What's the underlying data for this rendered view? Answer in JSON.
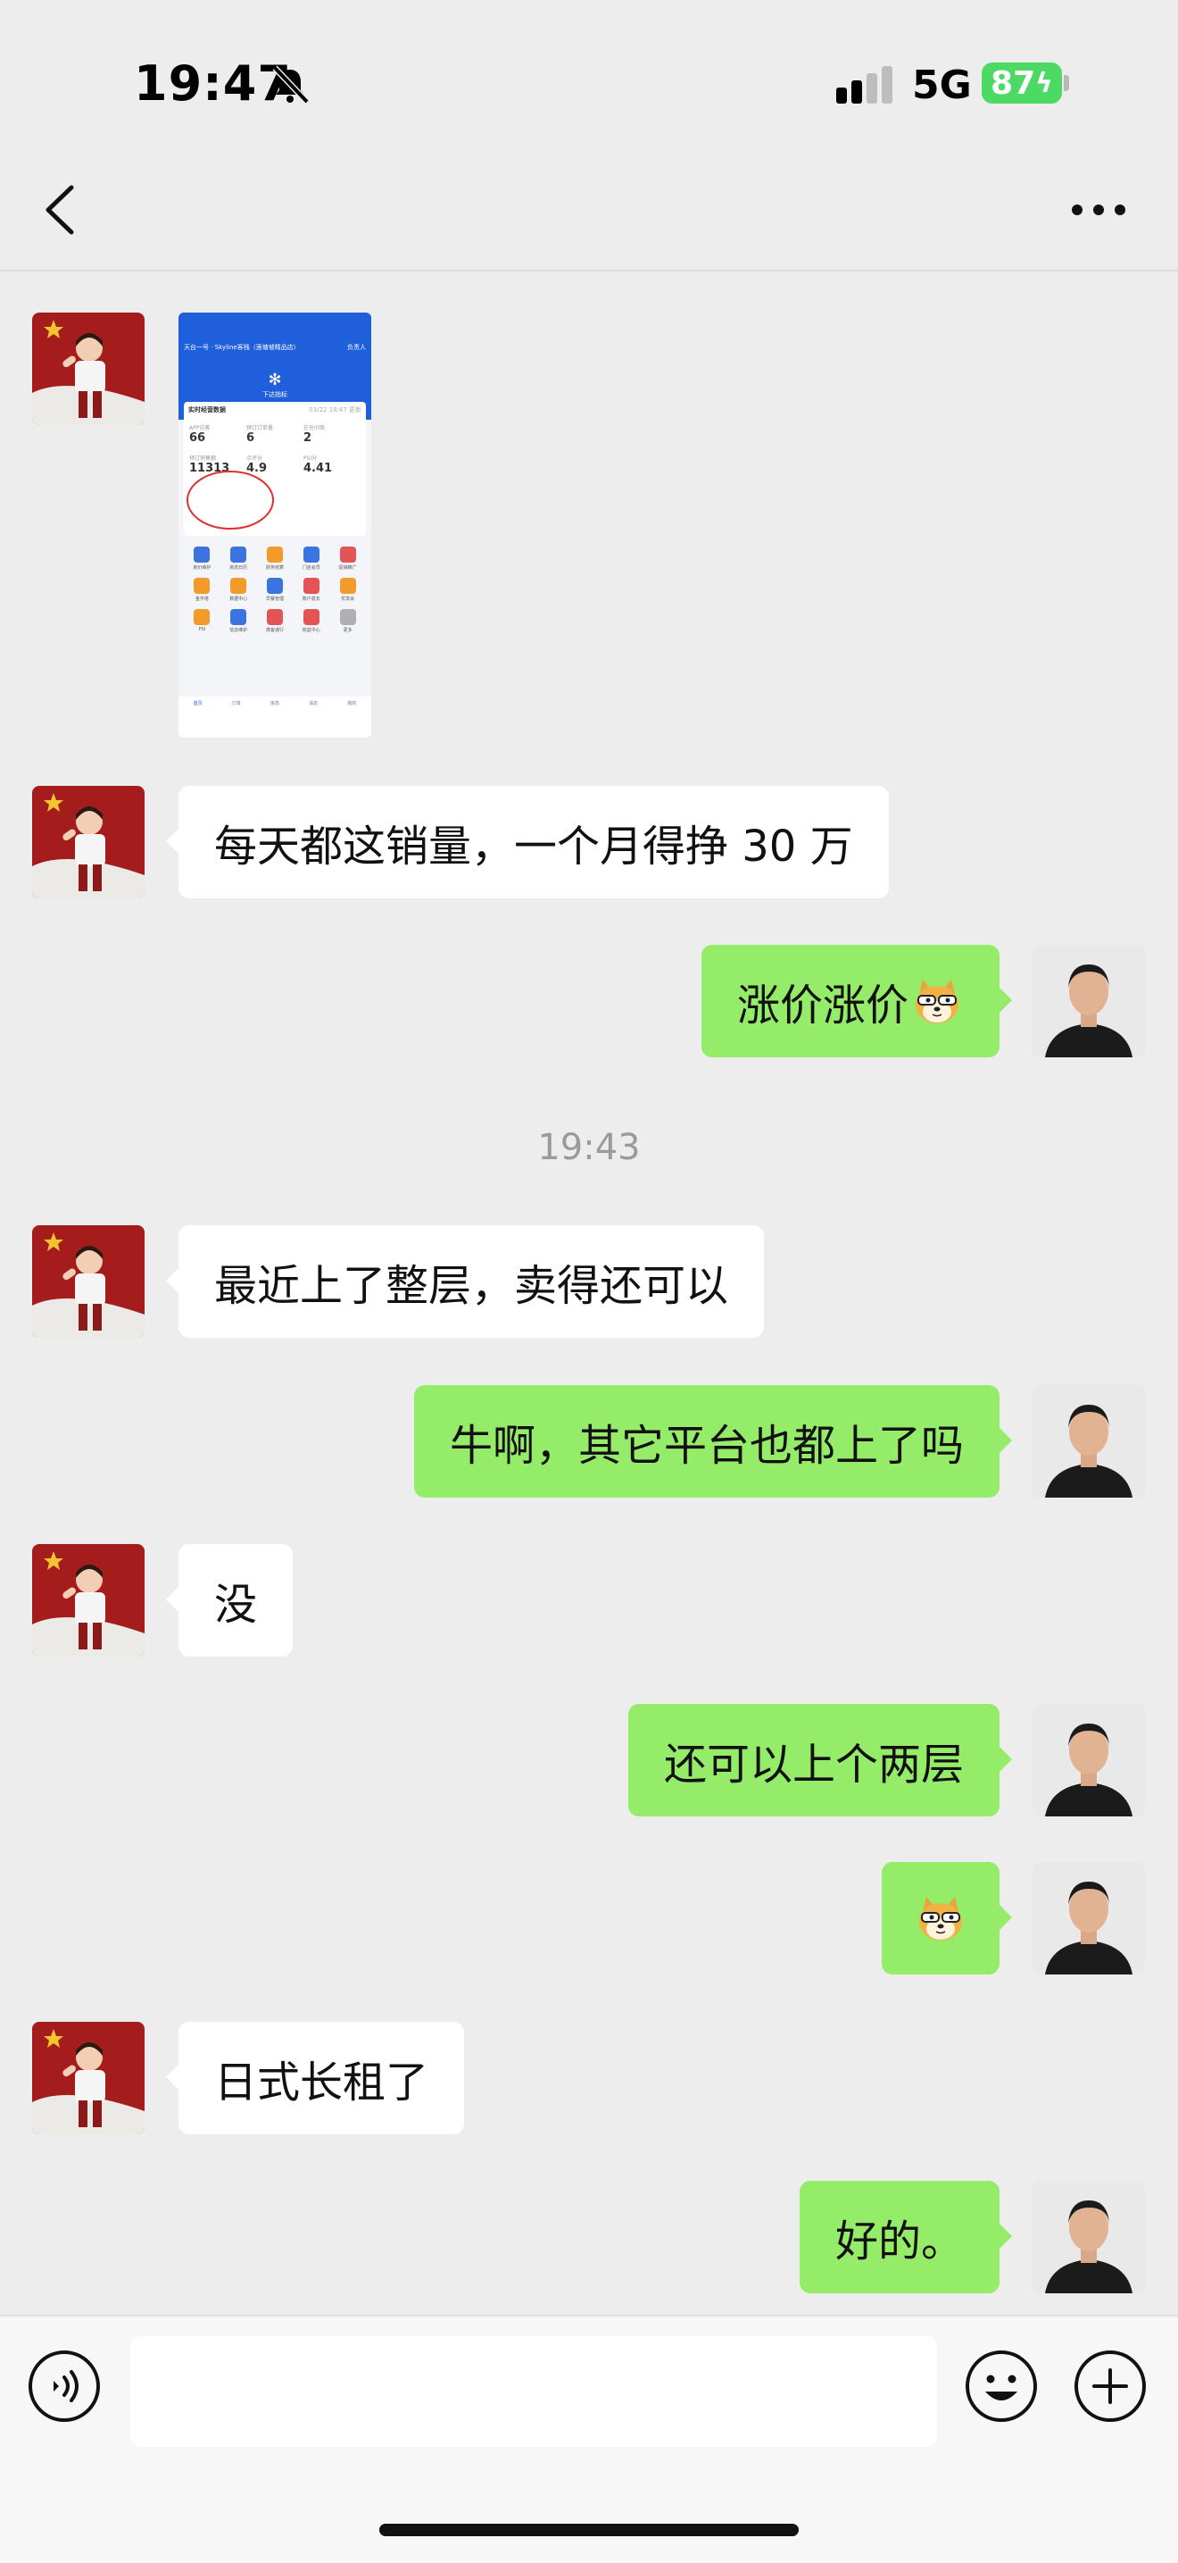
{
  "status_bar": {
    "time": "19:47",
    "network": "5G",
    "battery": "87"
  },
  "timestamp": "19:43",
  "messages": [
    {
      "side": "other",
      "type": "image"
    },
    {
      "side": "other",
      "type": "text",
      "text": "每天都这销量，一个月得挣 30 万"
    },
    {
      "side": "self",
      "type": "text",
      "text": "涨价涨价"
    },
    {
      "side": "other",
      "type": "text",
      "text": "最近上了整层，卖得还可以"
    },
    {
      "side": "self",
      "type": "text",
      "text": "牛啊，其它平台也都上了吗"
    },
    {
      "side": "other",
      "type": "text",
      "text": "没"
    },
    {
      "side": "self",
      "type": "text",
      "text": "还可以上个两层"
    },
    {
      "side": "self",
      "type": "sticker",
      "icon": "doge-emoji-icon"
    },
    {
      "side": "other",
      "type": "text",
      "text": "日式长租了"
    },
    {
      "side": "self",
      "type": "text",
      "text": "好的。"
    }
  ],
  "shared_screenshot": {
    "header": "天台一号 · Skyline客栈（莲塘坡精品店）",
    "header_right": "负责人",
    "banner_label": "下达指标",
    "section_title": "实时经营数据",
    "section_time": "03/22 18:47 更新",
    "stats": [
      {
        "label": "APP访客",
        "value": "66"
      },
      {
        "label": "预订订单量",
        "value": "6"
      },
      {
        "label": "在住间夜",
        "value": "2"
      },
      {
        "label": "预订销售额",
        "value": "11313"
      },
      {
        "label": "点评分",
        "value": "4.9"
      },
      {
        "label": "PSI分",
        "value": "4.41"
      }
    ],
    "grid_items": [
      "房价维护",
      "房态日历",
      "财务结算",
      "门店会员",
      "促销推广",
      "金字塔",
      "数据中心",
      "早餐管理",
      "账户成长",
      "优享会",
      "PSI",
      "信息维护",
      "携客通行",
      "权益中心",
      "更多"
    ],
    "tabs": [
      "首页",
      "订单",
      "房态",
      "消息",
      "我的"
    ]
  },
  "colors": {
    "self_bubble": "#95ec69",
    "other_bubble": "#ffffff",
    "background": "#ededed"
  }
}
